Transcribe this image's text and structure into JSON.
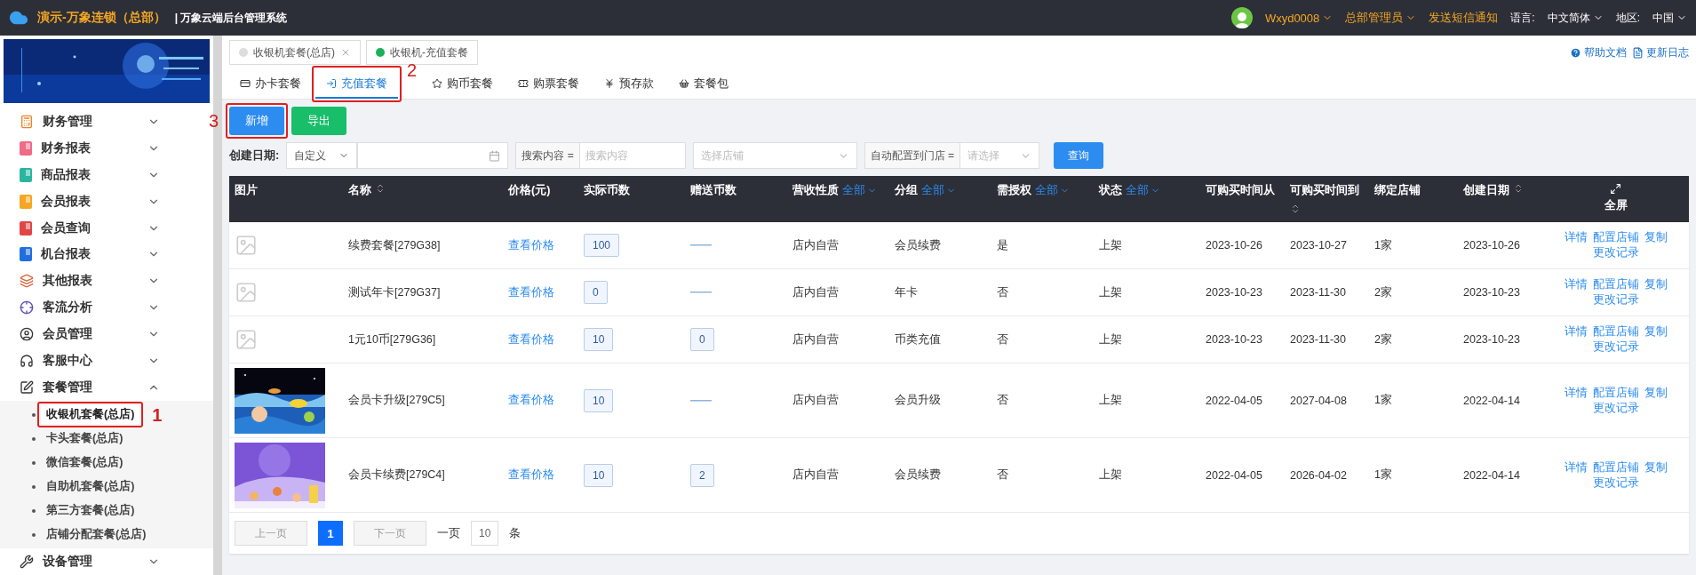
{
  "topbar": {
    "brand": "演示-万象连锁（总部）",
    "system": "| 万象云端后台管理系统",
    "user": "Wxyd0008",
    "role": "总部管理员",
    "notify": "发送短信通知",
    "language_label": "语言:",
    "language": "中文简体",
    "region_label": "地区:",
    "region": "中国"
  },
  "sidebar": {
    "items": [
      {
        "label": "财务管理",
        "kind": "calculator",
        "color": "#e8842c",
        "expanded": false
      },
      {
        "label": "财务报表",
        "kind": "report",
        "color": "#f06b86",
        "expanded": false
      },
      {
        "label": "商品报表",
        "kind": "report",
        "color": "#2bb5a0",
        "expanded": false
      },
      {
        "label": "会员报表",
        "kind": "report",
        "color": "#f5a623",
        "expanded": false
      },
      {
        "label": "会员查询",
        "kind": "report",
        "color": "#e04646",
        "expanded": false
      },
      {
        "label": "机台报表",
        "kind": "report",
        "color": "#1f6fe0",
        "expanded": false
      },
      {
        "label": "其他报表",
        "kind": "layers",
        "color": "#d9653b",
        "expanded": false
      },
      {
        "label": "客流分析",
        "kind": "target",
        "color": "#5a4fb5",
        "expanded": false
      },
      {
        "label": "会员管理",
        "kind": "user",
        "expanded": false
      },
      {
        "label": "客服中心",
        "kind": "headset",
        "expanded": false
      },
      {
        "label": "套餐管理",
        "kind": "edit",
        "expanded": true,
        "children": [
          {
            "label": "收银机套餐(总店)",
            "selected": true,
            "annotation": "1"
          },
          {
            "label": "卡头套餐(总店)",
            "selected": false
          },
          {
            "label": "微信套餐(总店)",
            "selected": false
          },
          {
            "label": "自助机套餐(总店)",
            "selected": false
          },
          {
            "label": "第三方套餐(总店)",
            "selected": false
          },
          {
            "label": "店铺分配套餐(总店)",
            "selected": false
          }
        ]
      },
      {
        "label": "设备管理",
        "kind": "tool",
        "expanded": false
      }
    ]
  },
  "page_tabs": [
    {
      "label": "收银机套餐(总店)",
      "selected": false,
      "closable": true
    },
    {
      "label": "收银机-充值套餐",
      "selected": true,
      "closable": false
    }
  ],
  "help_links": [
    {
      "label": "帮助文档",
      "kind": "help"
    },
    {
      "label": "更新日志",
      "kind": "doc"
    }
  ],
  "sub_tabs": [
    {
      "label": "办卡套餐",
      "kind": "card",
      "selected": false
    },
    {
      "label": "充值套餐",
      "kind": "recharge",
      "selected": true,
      "annotation": "2"
    },
    {
      "label": "购币套餐",
      "kind": "star",
      "selected": false
    },
    {
      "label": "购票套餐",
      "kind": "ticket",
      "selected": false
    },
    {
      "label": "预存款",
      "kind": "yen",
      "selected": false
    },
    {
      "label": "套餐包",
      "kind": "basket",
      "selected": false
    }
  ],
  "actions": [
    {
      "label": "新增",
      "kind": "primary",
      "annotation": "3"
    },
    {
      "label": "导出",
      "kind": "success"
    }
  ],
  "filters": {
    "date_label": "创建日期:",
    "date_mode": "自定义",
    "search_label": "搜索内容 =",
    "search_placeholder": "搜索内容",
    "store_placeholder": "选择店铺",
    "auto_label": "自动配置到门店 =",
    "auto_placeholder": "请选择",
    "query_button": "查询"
  },
  "table": {
    "columns": [
      {
        "label": "图片",
        "sortable": false
      },
      {
        "label": "名称",
        "sortable": true
      },
      {
        "label": "价格(元)",
        "sortable": false
      },
      {
        "label": "实际币数",
        "sortable": false
      },
      {
        "label": "赠送币数",
        "sortable": false
      },
      {
        "label": "营收性质",
        "filter": "全部",
        "sortable": false
      },
      {
        "label": "分组",
        "filter": "全部",
        "sortable": false
      },
      {
        "label": "需授权",
        "filter": "全部",
        "sortable": false
      },
      {
        "label": "状态",
        "filter": "全部",
        "sortable": false
      },
      {
        "label": "可购买时间从",
        "sortable": false
      },
      {
        "label": "可购买时间到",
        "sortable": true
      },
      {
        "label": "绑定店铺",
        "sortable": false
      },
      {
        "label": "创建日期",
        "sortable": true
      },
      {
        "label": "全屏",
        "kind": "fullscreen"
      }
    ],
    "rows": [
      {
        "kind": "placeholder",
        "name": "续费套餐[279G38]",
        "price": "查看价格",
        "coins": "100",
        "revenue": "店内自营",
        "group": "会员续费",
        "auth": "是",
        "status": "上架",
        "from": "2023-10-26",
        "to": "2023-10-27",
        "stores": "1家",
        "created": "2023-10-26",
        "links": [
          "详情",
          "配置店铺",
          "复制",
          "更改记录"
        ]
      },
      {
        "kind": "placeholder",
        "name": "测试年卡[279G37]",
        "price": "查看价格",
        "coins": "0",
        "revenue": "店内自营",
        "group": "年卡",
        "auth": "否",
        "status": "上架",
        "from": "2023-10-23",
        "to": "2023-11-30",
        "stores": "2家",
        "created": "2023-10-23",
        "links": [
          "详情",
          "配置店铺",
          "复制",
          "更改记录"
        ]
      },
      {
        "kind": "placeholder",
        "name": "1元10币[279G36]",
        "price": "查看价格",
        "coins": "10",
        "bonus": "0",
        "revenue": "店内自营",
        "group": "币类充值",
        "auth": "否",
        "status": "上架",
        "from": "2023-10-23",
        "to": "2023-11-30",
        "stores": "2家",
        "created": "2023-10-23",
        "links": [
          "详情",
          "配置店铺",
          "复制",
          "更改记录"
        ]
      },
      {
        "kind": "picture",
        "name": "会员卡升级[279C5]",
        "price": "查看价格",
        "coins": "10",
        "revenue": "店内自营",
        "group": "会员升级",
        "auth": "否",
        "status": "上架",
        "from": "2022-04-05",
        "to": "2027-04-08",
        "stores": "1家",
        "created": "2022-04-14",
        "links": [
          "详情",
          "配置店铺",
          "复制",
          "更改记录"
        ]
      },
      {
        "kind": "picture",
        "name": "会员卡续费[279C4]",
        "price": "查看价格",
        "coins": "10",
        "bonus": "2",
        "revenue": "店内自营",
        "group": "会员续费",
        "auth": "否",
        "status": "上架",
        "from": "2022-04-05",
        "to": "2026-04-02",
        "stores": "1家",
        "created": "2022-04-14",
        "links": [
          "详情",
          "配置店铺",
          "复制",
          "更改记录"
        ]
      }
    ]
  },
  "pagination": {
    "prev": "上一页",
    "pages": [
      {
        "label": "1",
        "selected": true
      }
    ],
    "next": "下一页",
    "size_label": "一页",
    "size": "10",
    "unit": "条"
  }
}
